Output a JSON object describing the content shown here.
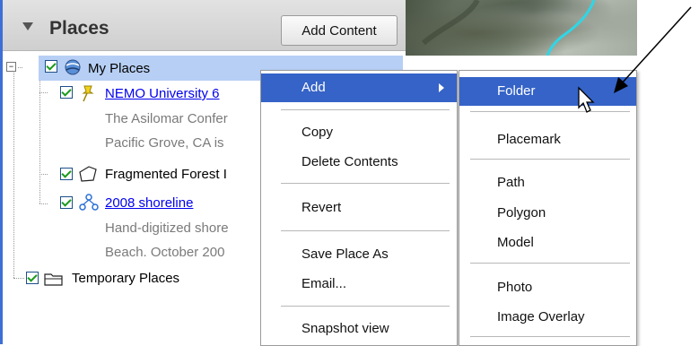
{
  "panel": {
    "title": "Places",
    "add_content_label": "Add Content"
  },
  "tree": {
    "my_places": {
      "label": "My Places",
      "expander": "−",
      "icon": "globe-icon",
      "checked": true
    },
    "items": [
      {
        "label": "NEMO University 6",
        "link": true,
        "icon": "pushpin-icon",
        "checked": true,
        "description": [
          "The Asilomar Confer",
          "Pacific Grove, CA is"
        ]
      },
      {
        "label": "Fragmented Forest I",
        "link": false,
        "icon": "polygon-icon",
        "checked": true,
        "description": []
      },
      {
        "label": "2008 shoreline",
        "link": true,
        "icon": "path-network-icon",
        "checked": true,
        "description": [
          "Hand-digitized shore",
          "Beach. October 200"
        ]
      }
    ],
    "temporary_places": {
      "label": "Temporary Places",
      "icon": "folder-icon",
      "checked": true
    }
  },
  "context_menu": {
    "items": [
      "Add",
      "Copy",
      "Delete Contents",
      "Revert",
      "Save Place As",
      "Email...",
      "Snapshot view"
    ],
    "active": "Add"
  },
  "submenu": {
    "items": [
      "Folder",
      "Placemark",
      "Path",
      "Polygon",
      "Model",
      "Photo",
      "Image Overlay"
    ],
    "active": "Folder"
  },
  "colors": {
    "selection": "#b7cff4",
    "menu_highlight": "#3563c7",
    "link": "#0000ee",
    "panel_border": "#3d6fd6"
  }
}
